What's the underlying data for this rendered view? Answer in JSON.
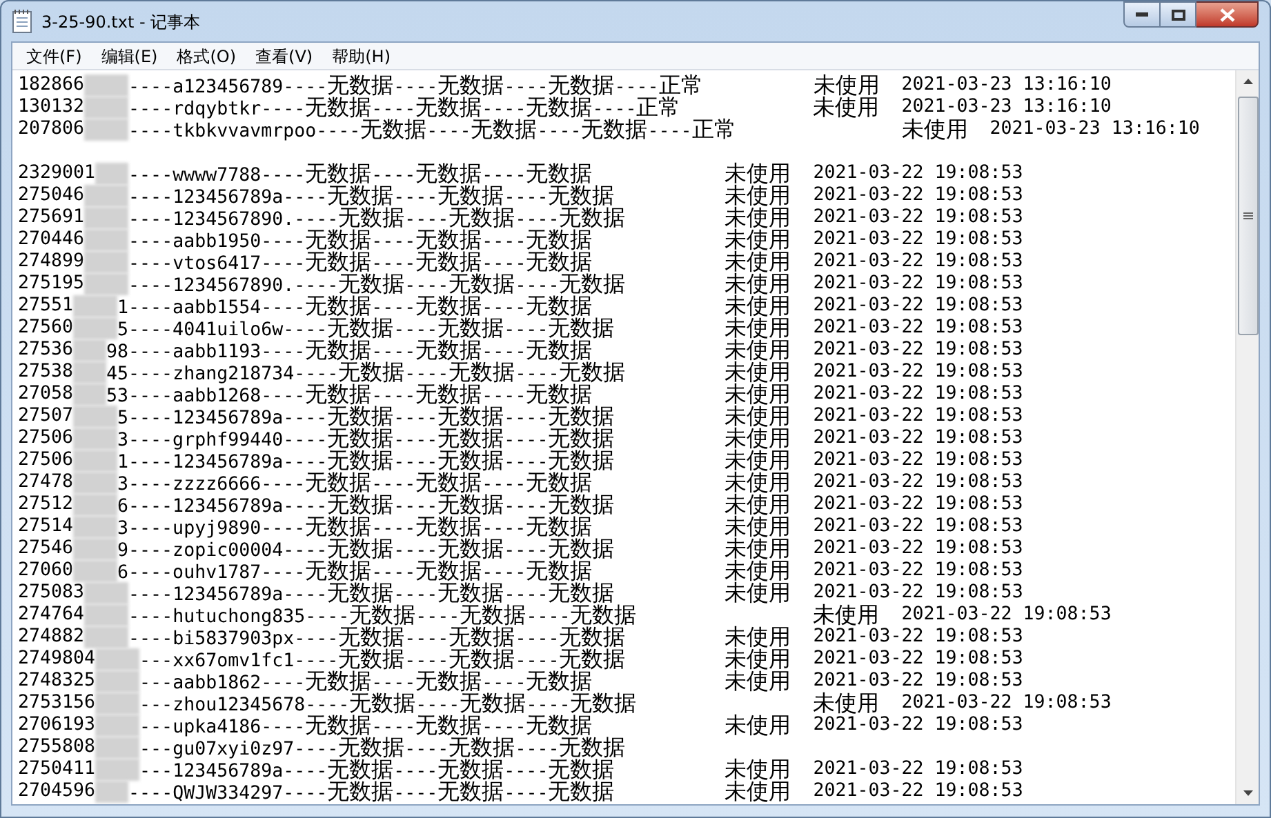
{
  "window": {
    "title": "3-25-90.txt - 记事本"
  },
  "menu": [
    {
      "label": "文件(F)"
    },
    {
      "label": "编辑(E)"
    },
    {
      "label": "格式(O)"
    },
    {
      "label": "查看(V)"
    },
    {
      "label": "帮助(H)"
    }
  ],
  "lines": [
    {
      "kind": "record",
      "id": "182866",
      "text": "----a123456789----无数据----无数据----无数据----正常",
      "status": "未使用",
      "time": "2021-03-23 13:16:10"
    },
    {
      "kind": "record",
      "id": "130132",
      "text": "----rdqybtkr----无数据----无数据----无数据----正常",
      "status": "未使用",
      "time": "2021-03-23 13:16:10"
    },
    {
      "kind": "record",
      "id": "207806",
      "text": "----tkbkvvavmrpoo----无数据----无数据----无数据----正常",
      "status": "未使用",
      "time": "2021-03-23 13:16:10"
    },
    {
      "kind": "blank"
    },
    {
      "kind": "record",
      "id": "2329001",
      "text": "----wwww7788----无数据----无数据----无数据",
      "status": "未使用",
      "time": "2021-03-22 19:08:53"
    },
    {
      "kind": "record",
      "id": "275046",
      "text": "----123456789a----无数据----无数据----无数据",
      "status": "未使用",
      "time": "2021-03-22 19:08:53"
    },
    {
      "kind": "record",
      "id": "275691",
      "text": "----1234567890.----无数据----无数据----无数据",
      "status": "未使用",
      "time": "2021-03-22 19:08:53"
    },
    {
      "kind": "record",
      "id": "270446",
      "text": "----aabb1950----无数据----无数据----无数据",
      "status": "未使用",
      "time": "2021-03-22 19:08:53"
    },
    {
      "kind": "record",
      "id": "274899",
      "text": "----vtos6417----无数据----无数据----无数据",
      "status": "未使用",
      "time": "2021-03-22 19:08:53"
    },
    {
      "kind": "record",
      "id": "275195",
      "text": "----1234567890.----无数据----无数据----无数据",
      "status": "未使用",
      "time": "2021-03-22 19:08:53"
    },
    {
      "kind": "record",
      "id": "27551",
      "text": "1----aabb1554----无数据----无数据----无数据",
      "status": "未使用",
      "time": "2021-03-22 19:08:53"
    },
    {
      "kind": "record",
      "id": "27560",
      "text": "5----4041uilo6w----无数据----无数据----无数据",
      "status": "未使用",
      "time": "2021-03-22 19:08:53"
    },
    {
      "kind": "record",
      "id": "27536",
      "text": "98----aabb1193----无数据----无数据----无数据",
      "status": "未使用",
      "time": "2021-03-22 19:08:53"
    },
    {
      "kind": "record",
      "id": "27538",
      "text": "45----zhang218734----无数据----无数据----无数据",
      "status": "未使用",
      "time": "2021-03-22 19:08:53"
    },
    {
      "kind": "record",
      "id": "27058",
      "text": "53----aabb1268----无数据----无数据----无数据",
      "status": "未使用",
      "time": "2021-03-22 19:08:53"
    },
    {
      "kind": "record",
      "id": "27507",
      "text": "5----123456789a----无数据----无数据----无数据",
      "status": "未使用",
      "time": "2021-03-22 19:08:53"
    },
    {
      "kind": "record",
      "id": "27506",
      "text": "3----grphf99440----无数据----无数据----无数据",
      "status": "未使用",
      "time": "2021-03-22 19:08:53"
    },
    {
      "kind": "record",
      "id": "27506",
      "text": "1----123456789a----无数据----无数据----无数据",
      "status": "未使用",
      "time": "2021-03-22 19:08:53"
    },
    {
      "kind": "record",
      "id": "27478",
      "text": "3----zzzz6666----无数据----无数据----无数据",
      "status": "未使用",
      "time": "2021-03-22 19:08:53"
    },
    {
      "kind": "record",
      "id": "27512",
      "text": "6----123456789a----无数据----无数据----无数据",
      "status": "未使用",
      "time": "2021-03-22 19:08:53"
    },
    {
      "kind": "record",
      "id": "27514",
      "text": "3----upyj9890----无数据----无数据----无数据",
      "status": "未使用",
      "time": "2021-03-22 19:08:53"
    },
    {
      "kind": "record",
      "id": "27546",
      "text": "9----zopic00004----无数据----无数据----无数据",
      "status": "未使用",
      "time": "2021-03-22 19:08:53"
    },
    {
      "kind": "record",
      "id": "27060",
      "text": "6----ouhv1787----无数据----无数据----无数据",
      "status": "未使用",
      "time": "2021-03-22 19:08:53"
    },
    {
      "kind": "record",
      "id": "275083",
      "text": "----123456789a----无数据----无数据----无数据",
      "status": "未使用",
      "time": "2021-03-22 19:08:53"
    },
    {
      "kind": "record",
      "id": "274764",
      "text": "----hutuchong835----无数据----无数据----无数据",
      "status": "未使用",
      "time": "2021-03-22 19:08:53"
    },
    {
      "kind": "record",
      "id": "274882",
      "text": "----bi5837903px----无数据----无数据----无数据",
      "status": "未使用",
      "time": "2021-03-22 19:08:53"
    },
    {
      "kind": "record",
      "id": "2749804",
      "text": "---xx67omv1fc1----无数据----无数据----无数据",
      "status": "未使用",
      "time": "2021-03-22 19:08:53"
    },
    {
      "kind": "record",
      "id": "2748325",
      "text": "---aabb1862----无数据----无数据----无数据",
      "status": "未使用",
      "time": "2021-03-22 19:08:53"
    },
    {
      "kind": "record",
      "id": "2753156",
      "text": "---zhou12345678----无数据----无数据----无数据",
      "status": "未使用",
      "time": "2021-03-22 19:08:53"
    },
    {
      "kind": "record",
      "id": "2706193",
      "text": "---upka4186----无数据----无数据----无数据",
      "status": "未使用",
      "time": "2021-03-22 19:08:53"
    },
    {
      "kind": "record",
      "id": "2755808",
      "text": "---gu07xyi0z97----无数据----无数据----无数据"
    },
    {
      "kind": "record",
      "id": "2750411",
      "text": "---123456789a----无数据----无数据----无数据",
      "status": "未使用",
      "time": "2021-03-22 19:08:53"
    },
    {
      "kind": "record",
      "id": "2704596",
      "text": "----QWJW334297----无数据----无数据----无数据",
      "status": "未使用",
      "time": "2021-03-22 19:08:53"
    }
  ]
}
